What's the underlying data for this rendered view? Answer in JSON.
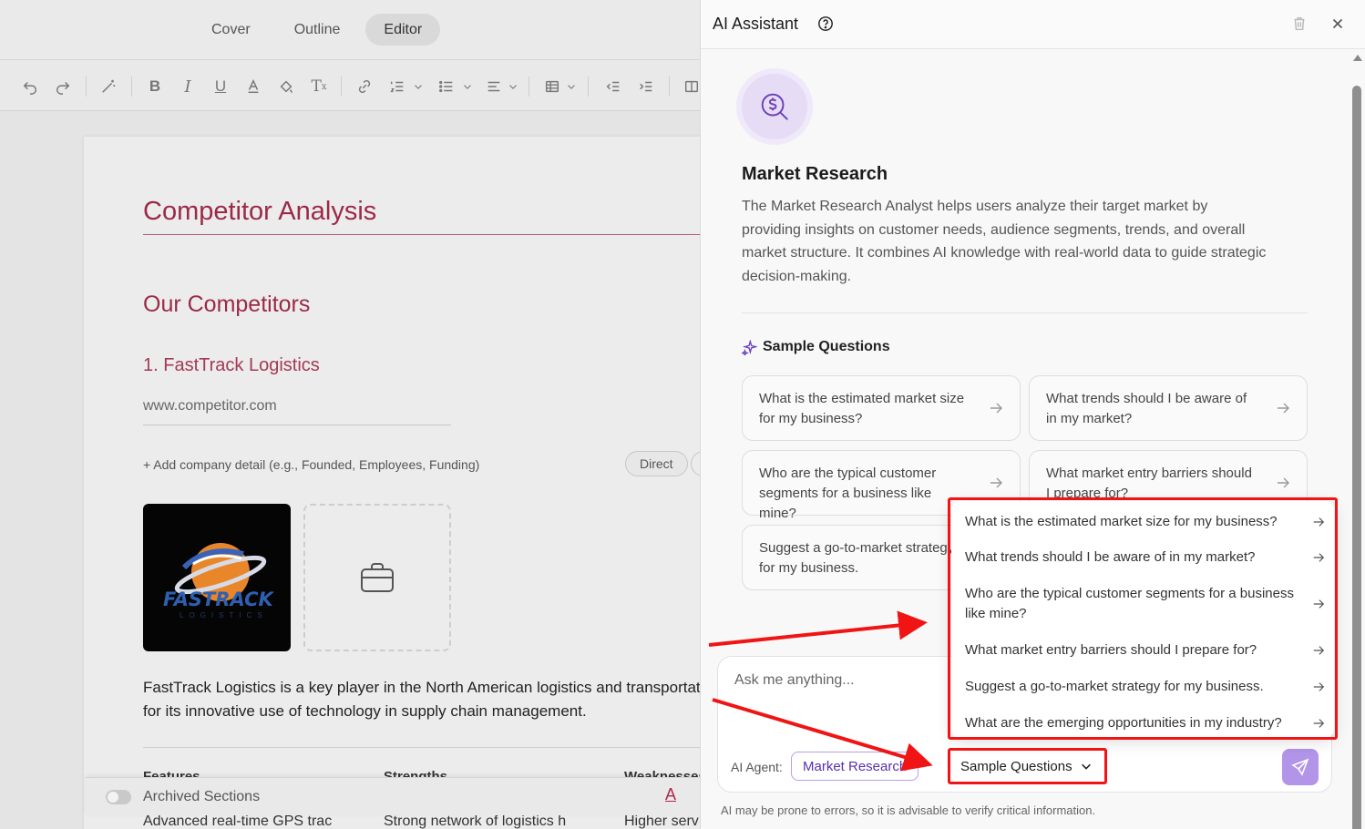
{
  "editor": {
    "tabs": [
      {
        "label": "Cover"
      },
      {
        "label": "Outline"
      },
      {
        "label": "Editor"
      }
    ],
    "doc_title": "Competitor Analysis",
    "section_title": "Our Competitors",
    "competitor_title": "1. FastTrack Logistics",
    "website": "www.competitor.com",
    "add_detail": "+ Add company detail (e.g., Founded, Employees, Funding)",
    "type_chip": "Direct",
    "logo_text": "FASTRACK",
    "logo_subtext": "LOGISTICS",
    "description_line1": "FastTrack Logistics is a key player in the North American logistics and transportat",
    "description_line2": "for its innovative use of technology in supply chain management.",
    "table": {
      "headers": [
        "Features",
        "Strengths",
        "Weaknesses"
      ],
      "cells": [
        "Advanced real-time GPS trac",
        "Strong network of logistics h",
        "Higher serv"
      ]
    },
    "archived_label": "Archived Sections"
  },
  "assistant": {
    "title": "AI Assistant",
    "agent_name": "Market Research",
    "agent_description": "The Market Research Analyst helps users analyze their target market by providing insights on customer needs, audience segments, trends, and overall market structure. It combines AI knowledge with real-world data to guide strategic decision-making.",
    "sample_questions_title": "Sample Questions",
    "cards": [
      {
        "text": "What is the estimated market size for my business?"
      },
      {
        "text": "What trends should I be aware of in my market?"
      },
      {
        "text": "Who are the typical customer segments for a business like mine?"
      },
      {
        "text": "What market entry barriers should I prepare for?"
      },
      {
        "text": "Suggest a go-to-market strategy for my business."
      }
    ],
    "input_placeholder": "Ask me anything...",
    "agent_label": "AI Agent:",
    "agent_pill": "Market Research",
    "sample_questions_button": "Sample Questions",
    "disclaimer": "AI may be prone to errors, so it is advisable to verify critical information.",
    "dropdown": [
      {
        "text": "What is the estimated market size for my business?"
      },
      {
        "text": "What trends should I be aware of in my market?"
      },
      {
        "text": "Who are the typical customer segments for a business like mine?"
      },
      {
        "text": "What market entry barriers should I prepare for?"
      },
      {
        "text": "Suggest a go-to-market strategy for my business."
      },
      {
        "text": "What are the emerging opportunities in my industry?"
      }
    ]
  },
  "colors": {
    "accent_purple": "#6b3fb5",
    "doc_heading": "#9b2a48",
    "annotation_red": "#f01414"
  }
}
